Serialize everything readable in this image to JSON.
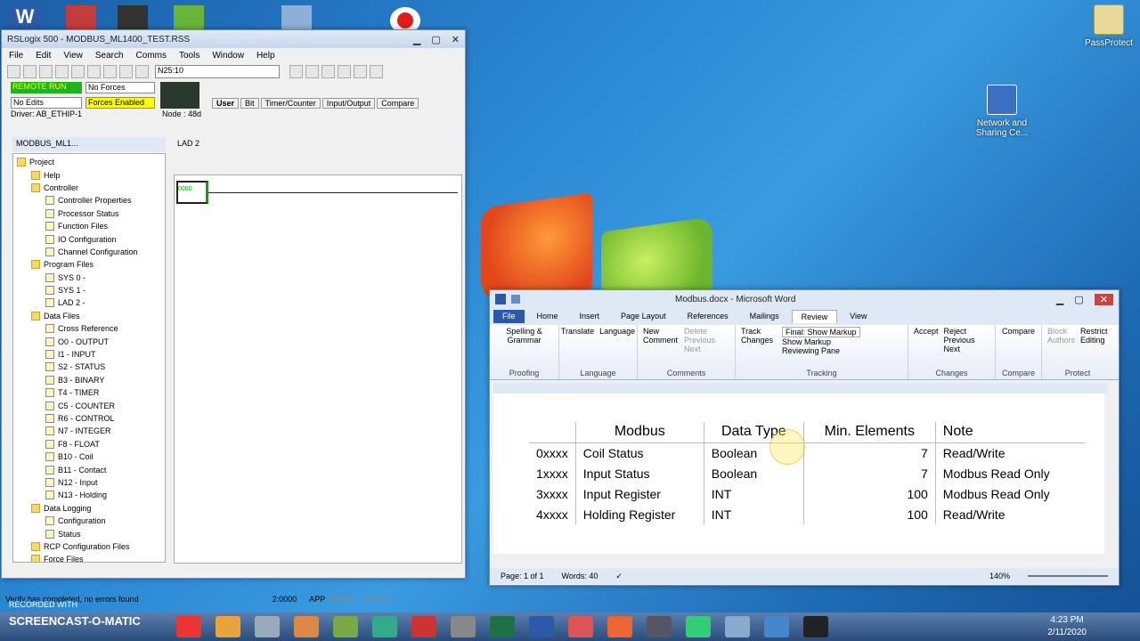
{
  "desktop": {
    "icons": [
      {
        "label": "PassProtect"
      },
      {
        "label": "Network and Sharing Ce..."
      }
    ]
  },
  "rslogix": {
    "title": "RSLogix 500 - MODBUS_ML1400_TEST.RSS",
    "menu": [
      "File",
      "Edit",
      "View",
      "Search",
      "Comms",
      "Tools",
      "Window",
      "Help"
    ],
    "address_box": "N25:10",
    "mode": "REMOTE RUN",
    "forces": "No Forces",
    "edits": "No Edits",
    "forces_enabled": "Forces Enabled",
    "driver": "Driver: AB_ETHIP-1",
    "node": "Node : 48d",
    "instr_tabs": [
      "User",
      "Bit",
      "Timer/Counter",
      "Input/Output",
      "Compare"
    ],
    "project_window_title": "MODBUS_ML1...",
    "lad_window_title": "LAD 2",
    "rung_label": "0000",
    "tree": [
      {
        "label": "Project",
        "level": 0,
        "folder": true
      },
      {
        "label": "Help",
        "level": 1,
        "folder": true
      },
      {
        "label": "Controller",
        "level": 1,
        "folder": true
      },
      {
        "label": "Controller Properties",
        "level": 2
      },
      {
        "label": "Processor Status",
        "level": 2
      },
      {
        "label": "Function Files",
        "level": 2
      },
      {
        "label": "IO Configuration",
        "level": 2
      },
      {
        "label": "Channel Configuration",
        "level": 2
      },
      {
        "label": "Program Files",
        "level": 1,
        "folder": true
      },
      {
        "label": "SYS 0 -",
        "level": 2
      },
      {
        "label": "SYS 1 -",
        "level": 2
      },
      {
        "label": "LAD 2 -",
        "level": 2
      },
      {
        "label": "Data Files",
        "level": 1,
        "folder": true
      },
      {
        "label": "Cross Reference",
        "level": 2
      },
      {
        "label": "O0 - OUTPUT",
        "level": 2
      },
      {
        "label": "I1 - INPUT",
        "level": 2
      },
      {
        "label": "S2 - STATUS",
        "level": 2
      },
      {
        "label": "B3 - BINARY",
        "level": 2
      },
      {
        "label": "T4 - TIMER",
        "level": 2
      },
      {
        "label": "C5 - COUNTER",
        "level": 2
      },
      {
        "label": "R6 - CONTROL",
        "level": 2
      },
      {
        "label": "N7 - INTEGER",
        "level": 2
      },
      {
        "label": "F8 - FLOAT",
        "level": 2
      },
      {
        "label": "B10 - Coil",
        "level": 2
      },
      {
        "label": "B11 - Contact",
        "level": 2
      },
      {
        "label": "N12 - Input",
        "level": 2
      },
      {
        "label": "N13 - Holding",
        "level": 2
      },
      {
        "label": "Data Logging",
        "level": 1,
        "folder": true
      },
      {
        "label": "Configuration",
        "level": 2
      },
      {
        "label": "Status",
        "level": 2
      },
      {
        "label": "RCP Configuration Files",
        "level": 1,
        "folder": true
      },
      {
        "label": "Force Files",
        "level": 1,
        "folder": true
      }
    ],
    "status_msg": "Verify has completed, no errors found",
    "status_addr": "2:0000",
    "status_app": "APP",
    "status_read": "READ",
    "status_disabled": "Disabled"
  },
  "word": {
    "title": "Modbus.docx - Microsoft Word",
    "tabs": [
      "File",
      "Home",
      "Insert",
      "Page Layout",
      "References",
      "Mailings",
      "Review",
      "View"
    ],
    "active_tab": "Review",
    "groups": {
      "proofing": {
        "label": "Proofing",
        "spelling": "Spelling & Grammar"
      },
      "language": {
        "label": "Language",
        "translate": "Translate",
        "language": "Language"
      },
      "comments": {
        "label": "Comments",
        "new": "New Comment",
        "delete": "Delete",
        "previous": "Previous",
        "next": "Next"
      },
      "tracking": {
        "label": "Tracking",
        "track": "Track Changes",
        "markup": "Final: Show Markup",
        "show_markup": "Show Markup",
        "reviewing_pane": "Reviewing Pane"
      },
      "changes": {
        "label": "Changes",
        "accept": "Accept",
        "reject": "Reject",
        "previous": "Previous",
        "next": "Next"
      },
      "compare": {
        "label": "Compare",
        "compare": "Compare"
      },
      "protect": {
        "label": "Protect",
        "block": "Block Authors",
        "restrict": "Restrict Editing"
      }
    },
    "table": {
      "headers": [
        "",
        "Modbus",
        "Data Type",
        "Min. Elements",
        "Note"
      ],
      "rows": [
        [
          "0xxxx",
          "Coil Status",
          "Boolean",
          "7",
          "Read/Write"
        ],
        [
          "1xxxx",
          "Input Status",
          "Boolean",
          "7",
          "Modbus Read Only"
        ],
        [
          "3xxxx",
          "Input Register",
          "INT",
          "100",
          "Modbus Read Only"
        ],
        [
          "4xxxx",
          "Holding Register",
          "INT",
          "100",
          "Read/Write"
        ]
      ]
    },
    "status_page": "Page: 1 of 1",
    "status_words": "Words: 40",
    "zoom": "140%"
  },
  "taskbar": {
    "recorded": "RECORDED WITH",
    "brand": "SCREENCAST-O-MATIC",
    "time": "4:23 PM",
    "date": "2/11/2020"
  }
}
